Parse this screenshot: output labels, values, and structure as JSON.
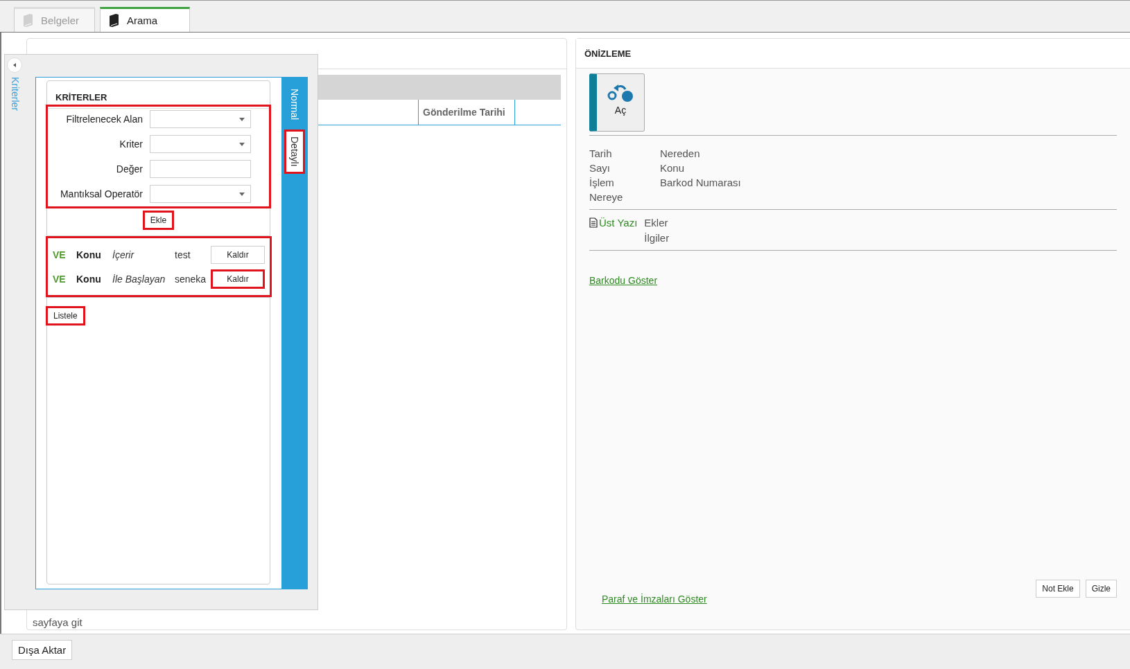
{
  "tabs": [
    {
      "label": "Belgeler",
      "selected": false,
      "disabled": true
    },
    {
      "label": "Arama",
      "selected": true,
      "disabled": false
    }
  ],
  "documents_panel": {
    "column_headers": [
      "Gönderilme Tarihi"
    ],
    "pager_text": "sayfaya git"
  },
  "criteria_drawer": {
    "handle_label": "Kriterler",
    "view_tabs": [
      {
        "label": "Normal",
        "selected": false,
        "highlighted": false
      },
      {
        "label": "Detaylı",
        "selected": true,
        "highlighted": true
      }
    ],
    "title": "KRİTERLER",
    "filter_form": {
      "highlighted": true,
      "fields": [
        {
          "label": "Filtrelenecek Alan",
          "kind": "dropdown"
        },
        {
          "label": "Kriter",
          "kind": "dropdown"
        },
        {
          "label": "Değer",
          "kind": "text"
        },
        {
          "label": "Mantıksal Operatör",
          "kind": "dropdown"
        }
      ]
    },
    "add_button": {
      "label": "Ekle",
      "highlighted": true
    },
    "criteria_list": {
      "highlighted": true,
      "rows": [
        {
          "operator": "VE",
          "field": "Konu",
          "condition": "İçerir",
          "value": "test",
          "remove_label": "Kaldır",
          "highlighted": false
        },
        {
          "operator": "VE",
          "field": "Konu",
          "condition": "İle Başlayan",
          "value": "seneka",
          "remove_label": "Kaldır",
          "highlighted": true
        }
      ]
    },
    "list_button": {
      "label": "Listele",
      "highlighted": true
    }
  },
  "preview": {
    "title": "ÖNİZLEME",
    "open_button": "Aç",
    "meta_left": [
      "Tarih",
      "Sayı",
      "İşlem",
      "Nereye"
    ],
    "meta_right": [
      "Nereden",
      "Konu",
      "Barkod Numarası"
    ],
    "main_document_link": "Üst Yazı",
    "attachments": [
      "Ekler",
      "İlgiler"
    ],
    "barcode_link": "Barkodu Göster",
    "signatures_link": "Paraf ve İmzaları Göster",
    "buttons": [
      "Not Ekle",
      "Gizle"
    ]
  },
  "footer": {
    "export_button": "Dışa Aktar"
  }
}
